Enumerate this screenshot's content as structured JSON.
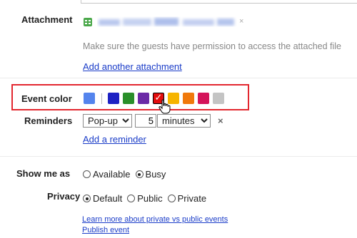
{
  "attachment": {
    "label": "Attachment",
    "permission_hint": "Make sure the guests have permission to access the attached file",
    "add_link": "Add another attachment"
  },
  "event_color": {
    "label": "Event color",
    "default_color": "#5484ed",
    "colors": [
      {
        "name": "blue",
        "hex": "#1d22c3"
      },
      {
        "name": "green",
        "hex": "#2a8f2a"
      },
      {
        "name": "purple",
        "hex": "#6b2aa6"
      },
      {
        "name": "red",
        "hex": "#e30d0d",
        "selected": true
      },
      {
        "name": "yellow",
        "hex": "#f6b400"
      },
      {
        "name": "orange",
        "hex": "#f0790c"
      },
      {
        "name": "pink",
        "hex": "#d4145a"
      },
      {
        "name": "gray",
        "hex": "#c4c4c4"
      }
    ],
    "check_glyph": "✓"
  },
  "reminders": {
    "label": "Reminders",
    "type_value": "Pop-up",
    "amount_value": "5",
    "unit_value": "minutes",
    "remove_glyph": "×",
    "add_link": "Add a reminder"
  },
  "show_me_as": {
    "label": "Show me as",
    "options": [
      {
        "label": "Available",
        "selected": false
      },
      {
        "label": "Busy",
        "selected": true
      }
    ]
  },
  "privacy": {
    "label": "Privacy",
    "options": [
      {
        "label": "Default",
        "selected": true
      },
      {
        "label": "Public",
        "selected": false
      },
      {
        "label": "Private",
        "selected": false
      }
    ],
    "learn_more_link": "Learn more about private vs public events",
    "publish_link": "Publish event"
  },
  "highlight_color": "#e3272f"
}
